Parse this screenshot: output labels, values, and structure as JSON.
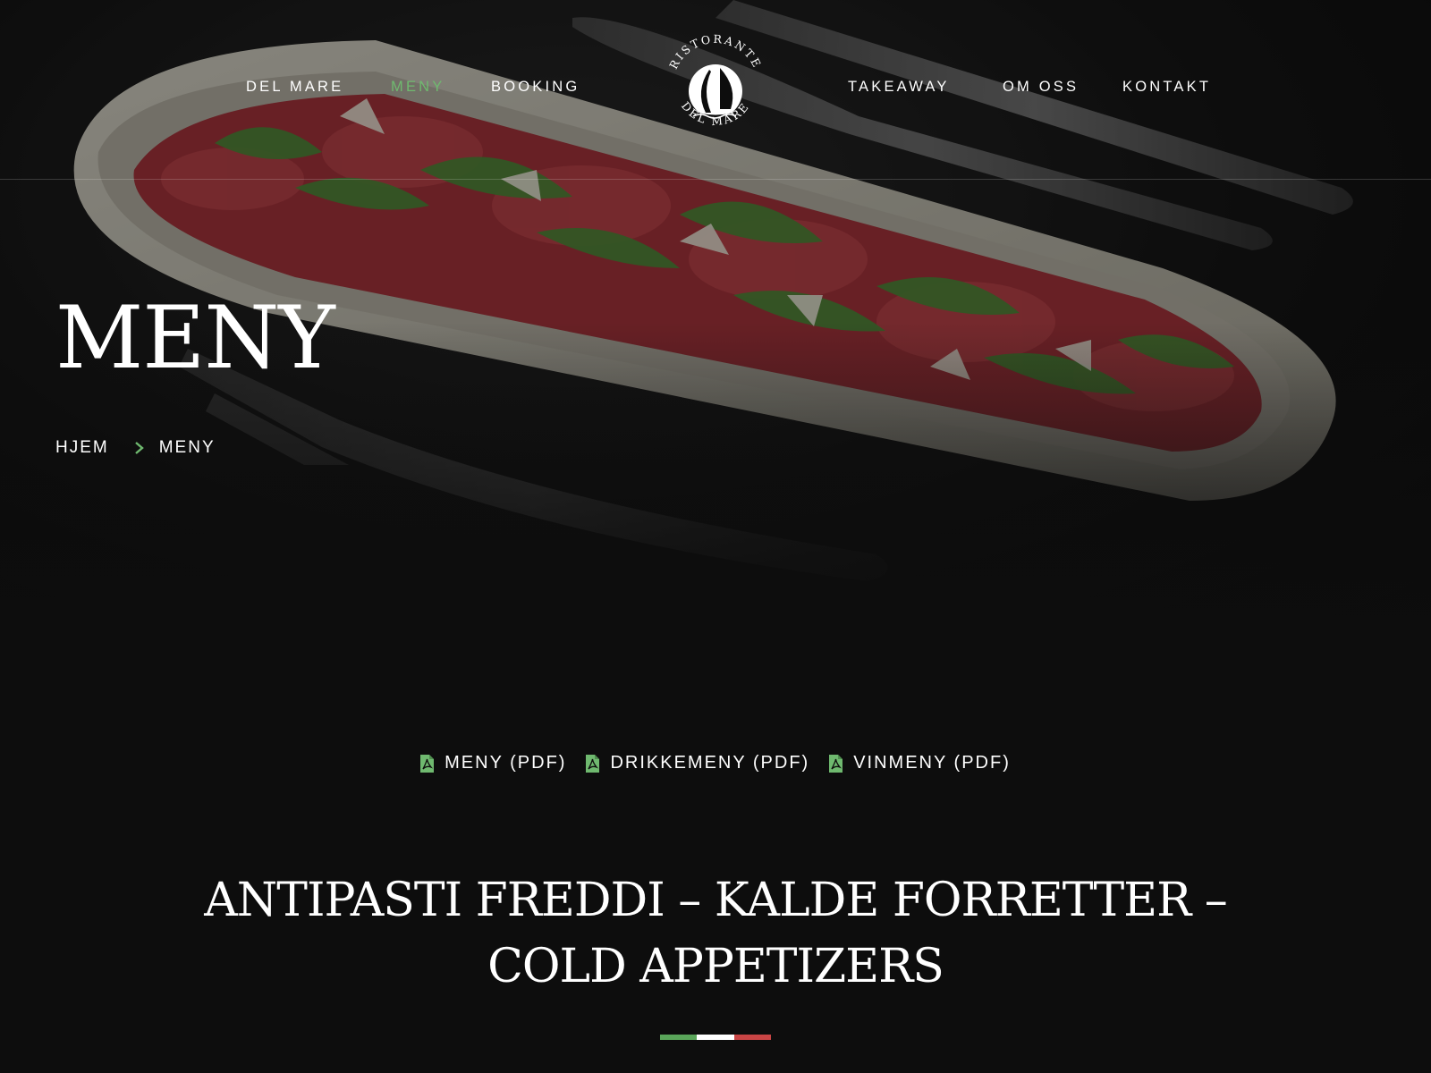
{
  "nav": {
    "left": [
      "DEL MARE",
      "MENY",
      "BOOKING"
    ],
    "right": [
      "TAKEAWAY",
      "OM OSS",
      "KONTAKT"
    ],
    "active": "MENY"
  },
  "logo": {
    "top_text": "RISTORANTE",
    "bottom_text": "DEL MARE"
  },
  "hero": {
    "title": "MENY",
    "breadcrumb": [
      "HJEM",
      "MENY"
    ]
  },
  "pdf_links": [
    {
      "label": "MENY (PDF)",
      "icon": "pdf-file-icon"
    },
    {
      "label": "DRIKKEMENY (PDF)",
      "icon": "pdf-file-icon"
    },
    {
      "label": "VINMENY (PDF)",
      "icon": "pdf-file-icon"
    }
  ],
  "section": {
    "heading": "ANTIPASTI FREDDI – KALDE FORRETTER – COLD APPETIZERS"
  },
  "colors": {
    "accent_green": "#6fb96f",
    "flag_green": "#5aa55a",
    "flag_white": "#ffffff",
    "flag_red": "#c94545",
    "background": "#0d0d0d"
  }
}
